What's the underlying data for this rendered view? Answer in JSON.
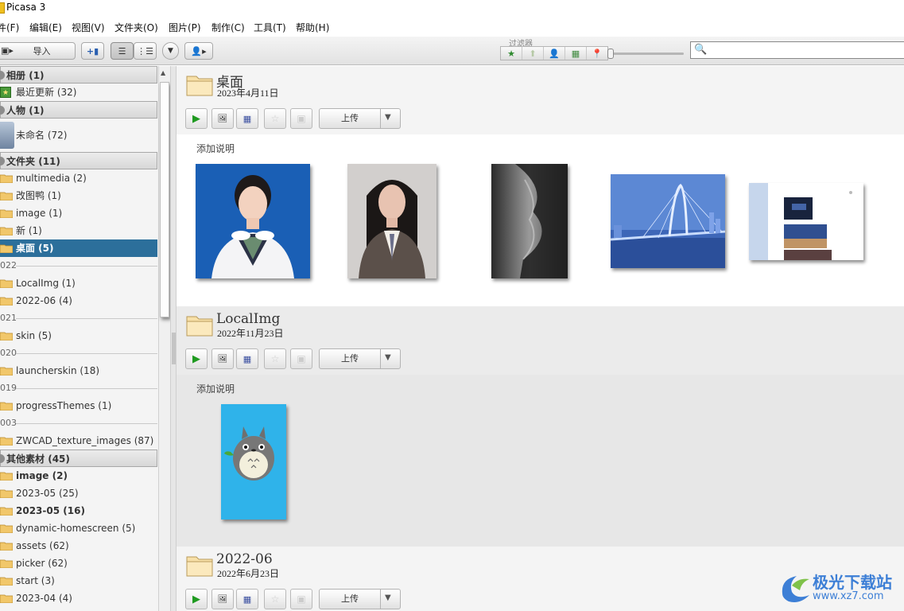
{
  "window": {
    "title": "Picasa 3"
  },
  "menu": [
    "件(F)",
    "编辑(E)",
    "视图(V)",
    "文件夹(O)",
    "图片(P)",
    "制作(C)",
    "工具(T)",
    "帮助(H)"
  ],
  "toolbar": {
    "import_label": "导入",
    "filter_label": "过滤器",
    "filter_buttons": [
      "★",
      "⬆",
      "👤",
      "▦",
      "📍"
    ],
    "search_placeholder": ""
  },
  "library": {
    "albums_header": {
      "label": "相册",
      "count": "(1)"
    },
    "albums": [
      {
        "label": "最近更新 (32)"
      }
    ],
    "people_header": {
      "label": "人物",
      "count": "(1)"
    },
    "people": [
      {
        "label": "未命名 (72)"
      }
    ],
    "folders_header": {
      "label": "文件夹",
      "count": "(11)"
    },
    "folders": [
      {
        "label": "multimedia (2)"
      },
      {
        "label": "改图鸭 (1)"
      },
      {
        "label": "image (1)"
      },
      {
        "label": "新 (1)"
      },
      {
        "label": "桌面 (5)",
        "selected": true
      }
    ],
    "years": [
      {
        "year": "022",
        "items": [
          {
            "label": "LocalImg (1)"
          },
          {
            "label": "2022-06 (4)"
          }
        ]
      },
      {
        "year": "021",
        "items": [
          {
            "label": "skin (5)"
          }
        ]
      },
      {
        "year": "020",
        "items": [
          {
            "label": "launcherskin (18)"
          }
        ]
      },
      {
        "year": "019",
        "items": [
          {
            "label": "progressThemes (1)"
          }
        ]
      },
      {
        "year": "003",
        "items": [
          {
            "label": "ZWCAD_texture_images (87)"
          }
        ]
      }
    ],
    "other_header": {
      "label": "其他素材",
      "count": "(45)"
    },
    "other": [
      {
        "label": "image (2)",
        "bold": true
      },
      {
        "label": "2023-05 (25)"
      },
      {
        "label": "2023-05 (16)",
        "bold": true
      },
      {
        "label": "dynamic-homescreen (5)"
      },
      {
        "label": "assets (62)"
      },
      {
        "label": "picker (62)"
      },
      {
        "label": "start (3)"
      },
      {
        "label": "2023-04 (4)"
      }
    ]
  },
  "albums_view": [
    {
      "title": "桌面",
      "date": "2023年4月11日",
      "upload_label": "上传",
      "caption": "添加说明",
      "thumb_names": [
        "photo-portrait-blue",
        "photo-portrait-grey",
        "photo-rocks-bw",
        "photo-bridge-night",
        "photo-screenshot-doc"
      ]
    },
    {
      "title": "LocalImg",
      "date": "2022年11月23日",
      "upload_label": "上传",
      "caption": "添加说明",
      "thumb_names": [
        "photo-totoro"
      ]
    },
    {
      "title": "2022-06",
      "date": "2022年6月23日",
      "upload_label": "上传"
    }
  ],
  "watermark": {
    "text": "极光下载站",
    "url": "www.xz7.com"
  },
  "colors": {
    "selection": "#2c6f9b",
    "play": "#1f9a20",
    "watermark": "#3d7fd6"
  }
}
